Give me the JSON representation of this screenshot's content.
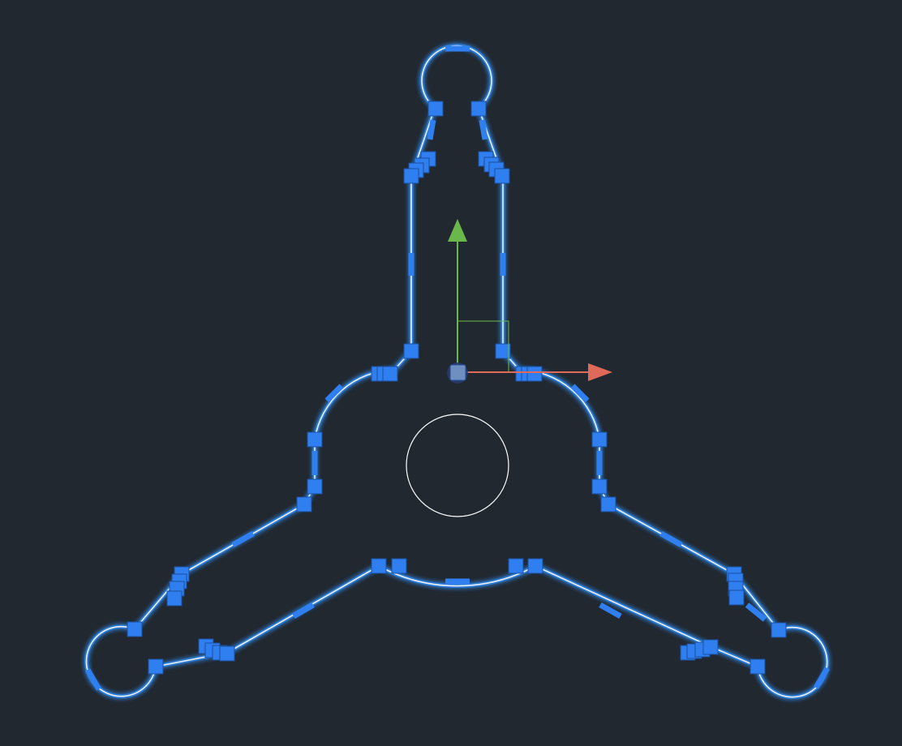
{
  "canvas": {
    "background": "#212830"
  },
  "colors": {
    "outline_glow": "#2f7fd8",
    "outline_core": "#eaf2ff",
    "grip": "#2f7ff0",
    "grip_stroke": "#1b4f9c",
    "circle": "#ffffff",
    "gizmo_x": "#e06a5a",
    "gizmo_y": "#6ab84c",
    "gizmo_base": "#6f8fc0"
  },
  "selection": {
    "selected_objects": "outline-loop",
    "grips_shown": true
  },
  "gizmo": {
    "type": "ucs-move-gizmo",
    "axes": [
      "x-axis",
      "y-axis"
    ]
  },
  "icons": {
    "grip": "square-grip-icon",
    "base_grip": "base-point-grip-icon",
    "x_arrow": "x-axis-arrow-icon",
    "y_arrow": "y-axis-arrow-icon"
  }
}
